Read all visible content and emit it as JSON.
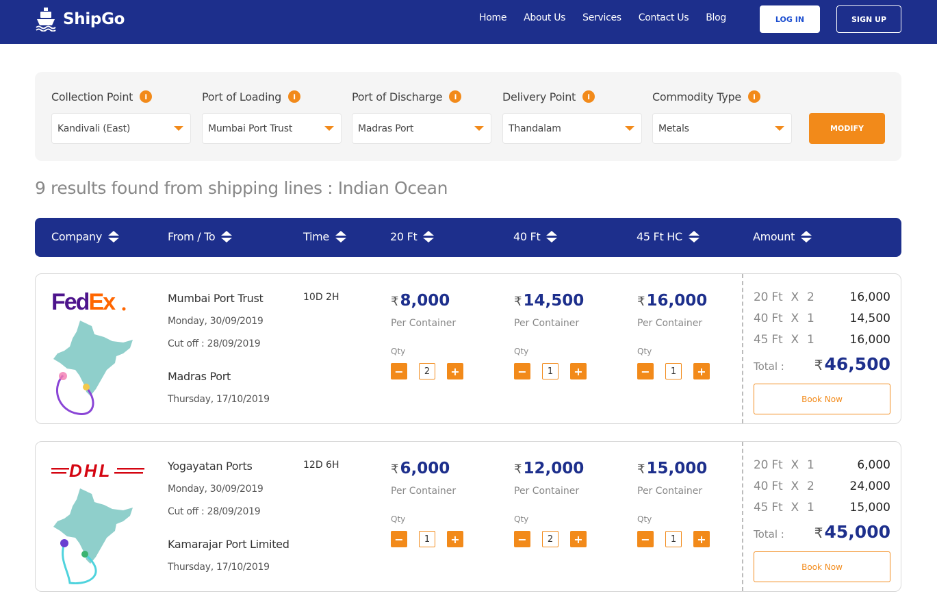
{
  "header": {
    "brand": "ShipGo",
    "nav": [
      "Home",
      "About Us",
      "Services",
      "Contact Us",
      "Blog"
    ],
    "login_label": "LOG IN",
    "signup_label": "SIGN UP"
  },
  "filters": {
    "fields": [
      {
        "label": "Collection Point",
        "value": "Kandivali (East)"
      },
      {
        "label": "Port of Loading",
        "value": "Mumbai Port Trust"
      },
      {
        "label": "Port of Discharge",
        "value": "Madras Port"
      },
      {
        "label": "Delivery Point",
        "value": "Thandalam"
      },
      {
        "label": "Commodity Type",
        "value": "Metals"
      }
    ],
    "info_glyph": "i",
    "modify_label": "MODIFY"
  },
  "results_title": "9 results found from shipping lines : Indian Ocean",
  "table_headers": [
    "Company",
    "From / To",
    "Time",
    "20 Ft",
    "40 Ft",
    "45 Ft HC",
    "Amount"
  ],
  "colors": {
    "primary": "#1d2f8c",
    "accent": "#f28a1a"
  },
  "results": [
    {
      "company": "FedEx",
      "logo_icon": "fedex-logo",
      "from_port": "Mumbai Port Trust",
      "from_date": "Monday, 30/09/2019",
      "cutoff": "Cut off : 28/09/2019",
      "to_port": "Madras Port",
      "to_date": "Thursday, 17/10/2019",
      "time": "10D 2H",
      "currency": "₹",
      "per_container": "Per Container",
      "qty_label": "Qty",
      "prices": [
        {
          "amount": "8,000",
          "qty": "2"
        },
        {
          "amount": "14,500",
          "qty": "1"
        },
        {
          "amount": "16,000",
          "qty": "1"
        }
      ],
      "summary": [
        {
          "size": "20 Ft",
          "x": "X",
          "qty": "2",
          "subtotal": "16,000"
        },
        {
          "size": "40 Ft",
          "x": "X",
          "qty": "1",
          "subtotal": "14,500"
        },
        {
          "size": "45 Ft",
          "x": "X",
          "qty": "1",
          "subtotal": "16,000"
        }
      ],
      "total_label": "Total :",
      "total": "46,500",
      "book_label": "Book Now"
    },
    {
      "company": "DHL",
      "logo_icon": "dhl-logo",
      "from_port": "Yogayatan Ports",
      "from_date": "Monday, 30/09/2019",
      "cutoff": "Cut off : 28/09/2019",
      "to_port": "Kamarajar Port Limited",
      "to_date": "Thursday, 17/10/2019",
      "time": "12D 6H",
      "currency": "₹",
      "per_container": "Per Container",
      "qty_label": "Qty",
      "prices": [
        {
          "amount": "6,000",
          "qty": "1"
        },
        {
          "amount": "12,000",
          "qty": "2"
        },
        {
          "amount": "15,000",
          "qty": "1"
        }
      ],
      "summary": [
        {
          "size": "20 Ft",
          "x": "X",
          "qty": "1",
          "subtotal": "6,000"
        },
        {
          "size": "40 Ft",
          "x": "X",
          "qty": "2",
          "subtotal": "24,000"
        },
        {
          "size": "45 Ft",
          "x": "X",
          "qty": "1",
          "subtotal": "15,000"
        }
      ],
      "total_label": "Total :",
      "total": "45,000",
      "book_label": "Book Now"
    }
  ]
}
